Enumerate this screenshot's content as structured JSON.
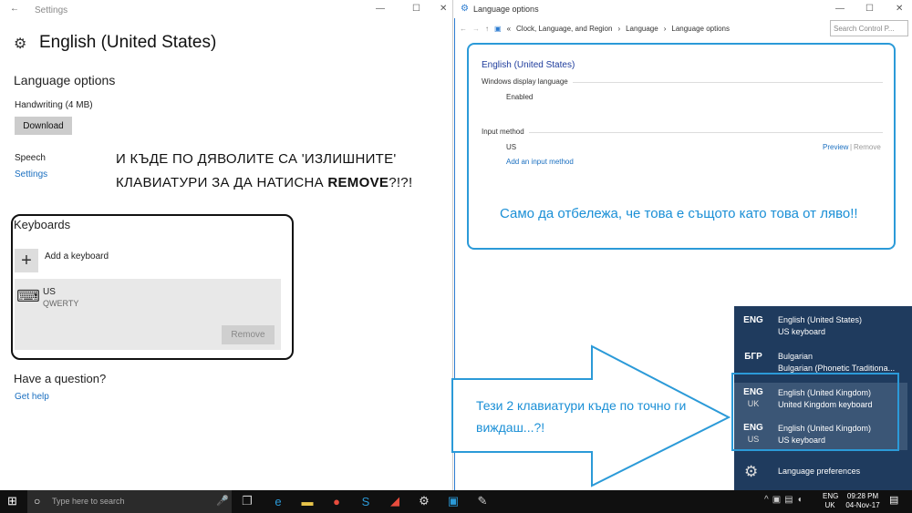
{
  "settings": {
    "window_title": "Settings",
    "heading": "English (United States)",
    "language_options": "Language options",
    "handwriting": "Handwriting (4 MB)",
    "download": "Download",
    "speech": "Speech",
    "speech_settings": "Settings",
    "keyboards": "Keyboards",
    "add_keyboard": "Add a keyboard",
    "kb_name": "US",
    "kb_layout": "QWERTY",
    "remove": "Remove",
    "question": "Have a question?",
    "get_help": "Get help",
    "annotation_line1": "И КЪДЕ ПО ДЯВОЛИТЕ СА 'ИЗЛИШНИТЕ'",
    "annotation_line2_pre": "КЛАВИАТУРИ ЗА ДА НАТИСНА ",
    "annotation_line2_bold": "REMOVE",
    "annotation_line2_post": "?!?!"
  },
  "control_panel": {
    "window_title": "Language options",
    "breadcrumb": [
      "Clock, Language, and Region",
      "Language",
      "Language options"
    ],
    "search_placeholder": "Search Control P...",
    "language": "English (United States)",
    "display_language_label": "Windows display language",
    "display_language_value": "Enabled",
    "input_method_label": "Input method",
    "input_method_value": "US",
    "preview": "Preview",
    "separator": "|",
    "remove": "Remove",
    "add_input_method": "Add an input method",
    "annotation": "Само да отбележа, че това е същото като това от ляво!!"
  },
  "flyout": {
    "items": [
      {
        "code": "ENG",
        "sub": "",
        "name": "English (United States)",
        "layout": "US keyboard"
      },
      {
        "code": "БГР",
        "sub": "",
        "name": "Bulgarian",
        "layout": "Bulgarian (Phonetic Traditiona..."
      },
      {
        "code": "ENG",
        "sub": "UK",
        "name": "English (United Kingdom)",
        "layout": "United Kingdom keyboard"
      },
      {
        "code": "ENG",
        "sub": "US",
        "name": "English (United Kingdom)",
        "layout": "US keyboard"
      }
    ],
    "preferences": "Language preferences"
  },
  "arrow_annotation": "Тези 2 клавиатури къде по точно ги виждаш...?!",
  "taskbar": {
    "search_placeholder": "Type here to search",
    "lang_code": "ENG",
    "lang_sub": "UK",
    "time": "09:28 PM",
    "date": "04-Nov-17"
  },
  "colors": {
    "accent_blue": "#2b9ad8",
    "flyout_bg": "#1f3b5e",
    "link": "#1a6fc0"
  }
}
